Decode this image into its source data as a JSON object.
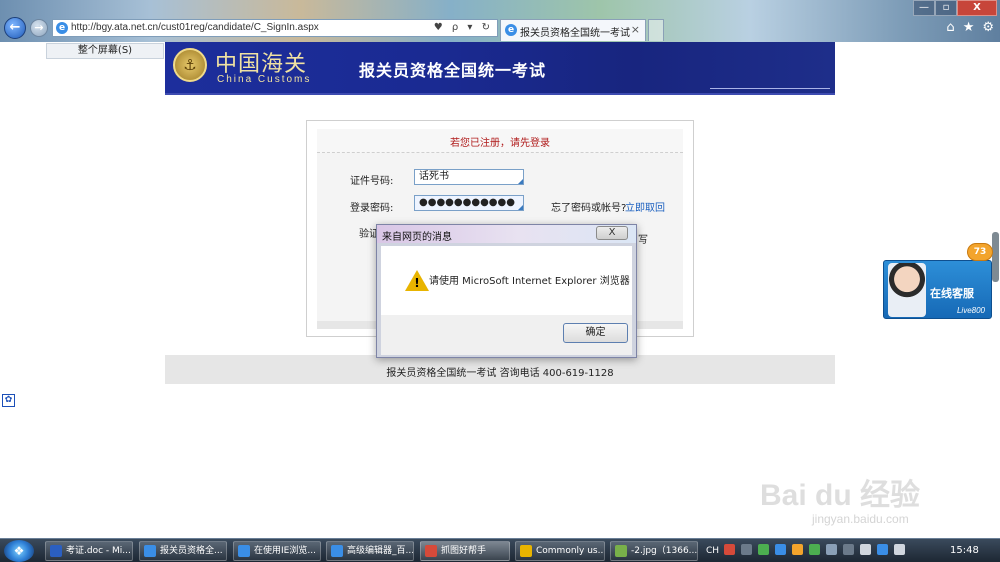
{
  "browser": {
    "url": "http://bgy.ata.net.cn/cust01reg/candidate/C_SignIn.aspx",
    "address_tools": "♥ ρ ▾ ↻",
    "tab_title": "报关员资格全国统一考试",
    "tab_close": "×",
    "window_controls": [
      "—",
      "▫",
      "X"
    ],
    "toolbar_icons": [
      "⌂",
      "★",
      "⚙"
    ],
    "toolbar_button": "整个屏幕(S)"
  },
  "header": {
    "logo_cn": "中国海关",
    "logo_en": "China Customs",
    "title": "报关员资格全国统一考试"
  },
  "login": {
    "notice": "若您已注册，请先登录",
    "id_label": "证件号码:",
    "id_value": "话死书",
    "password_label": "登录密码:",
    "password_value": "●●●●●●●●●●●",
    "forgot_text": "忘了密码或帐号?",
    "forgot_link": "立即取回",
    "captcha_label": "验证",
    "hint_char": "写"
  },
  "footer": {
    "text": "报关员资格全国统一考试 咨询电话 400-619-1128"
  },
  "dialog": {
    "title": "来自网页的消息",
    "close_label": "X",
    "message": "请使用 MicroSoft Internet Explorer 浏览器",
    "ok_label": "确定"
  },
  "widget": {
    "badge": "73",
    "label": "在线客服",
    "sub": "Live800"
  },
  "watermark": {
    "main": "Bai du 经验",
    "sub": "jingyan.baidu.com"
  },
  "taskbar": {
    "tasks": [
      {
        "label": "考证.doc - Mi...",
        "color": "#2b5fc1"
      },
      {
        "label": "报关员资格全...",
        "color": "#3a8ee6"
      },
      {
        "label": "在使用IE浏览...",
        "color": "#3a8ee6"
      },
      {
        "label": "高级编辑器_百...",
        "color": "#3a8ee6"
      },
      {
        "label": "抓图好帮手",
        "color": "#d64a3a"
      },
      {
        "label": "Commonly us...",
        "color": "#e8b400"
      },
      {
        "label": "-2.jpg（1366...",
        "color": "#79b04a"
      }
    ],
    "tray_lang": "CH",
    "clock": "15:48"
  }
}
